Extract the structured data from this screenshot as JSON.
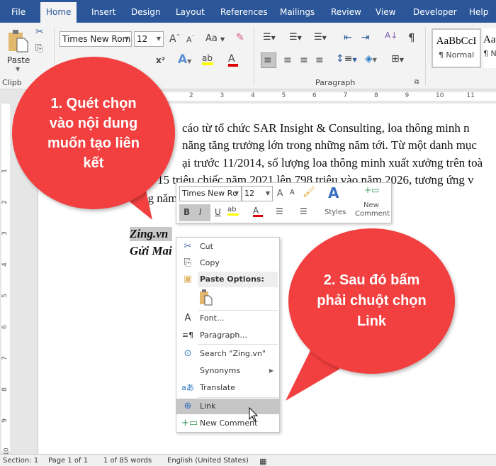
{
  "tabs": [
    "File",
    "Home",
    "Insert",
    "Design",
    "Layout",
    "References",
    "Mailings",
    "Review",
    "View",
    "Developer",
    "Help"
  ],
  "active_tab": "Home",
  "ribbon": {
    "paste_label": "Paste",
    "clipboard_group": "Clipb",
    "font_name": "Times New Rom",
    "font_size": "12",
    "change_case": "Aa",
    "paragraph_group": "Paragraph",
    "style_preview": "AaBbCcI",
    "style_name": "¶ Normal",
    "style2_preview": "Aa",
    "style2_name": "¶ N",
    "highlight_color": "#ffff00",
    "font_color": "#e00000"
  },
  "ruler_h": [
    "2",
    "3",
    "4",
    "5",
    "6",
    "7",
    "8",
    "9",
    "10",
    "11"
  ],
  "ruler_v": [
    "1",
    "2",
    "3",
    "4",
    "5",
    "6",
    "7",
    "8",
    "9",
    "10"
  ],
  "document": {
    "lines": [
      "cáo từ tổ chức SAR Insight & Consulting, loa thông minh n",
      "năng tăng trưởng lớn trong những năm tới. Từ một danh mục",
      "ại trước 11/2014, số lượng loa thông minh xuất xưởng trên toà",
      "15 triệu chiếc năm 2021 lên 798 triệu vào năm 2026, tương ứng v",
      "ng năm"
    ],
    "selected_text": "Zing.vn",
    "next_line": "Gửi Mai"
  },
  "mini_toolbar": {
    "font_name": "Times New Rc",
    "font_size": "12",
    "bold": "B",
    "italic": "I",
    "underline": "U",
    "styles_label": "Styles",
    "new_comment_label_1": "New",
    "new_comment_label_2": "Comment"
  },
  "context_menu": {
    "items": [
      {
        "label": "Cut",
        "icon": "scissors-icon"
      },
      {
        "label": "Copy",
        "icon": "copy-icon"
      },
      {
        "label": "Paste Options:",
        "icon": "paste-icon"
      },
      {
        "label": "Font...",
        "icon": "font-icon"
      },
      {
        "label": "Paragraph...",
        "icon": "paragraph-icon"
      },
      {
        "label": "Search \"Zing.vn\"",
        "icon": "search-icon"
      },
      {
        "label": "Synonyms",
        "icon": ""
      },
      {
        "label": "Translate",
        "icon": "translate-icon"
      },
      {
        "label": "Link",
        "icon": "link-icon"
      },
      {
        "label": "New Comment",
        "icon": "new-comment-icon"
      }
    ],
    "highlighted": "Link"
  },
  "callouts": {
    "first": "1. Quét chọn vào nội dung muốn tạo liên kết",
    "second": "2. Sau đó bấm phải chuột chọn Link",
    "color": "#f24040"
  },
  "status_bar": {
    "section": "Section: 1",
    "page": "Page 1 of 1",
    "words": "1 of 85 words",
    "language": "English (United States)"
  }
}
